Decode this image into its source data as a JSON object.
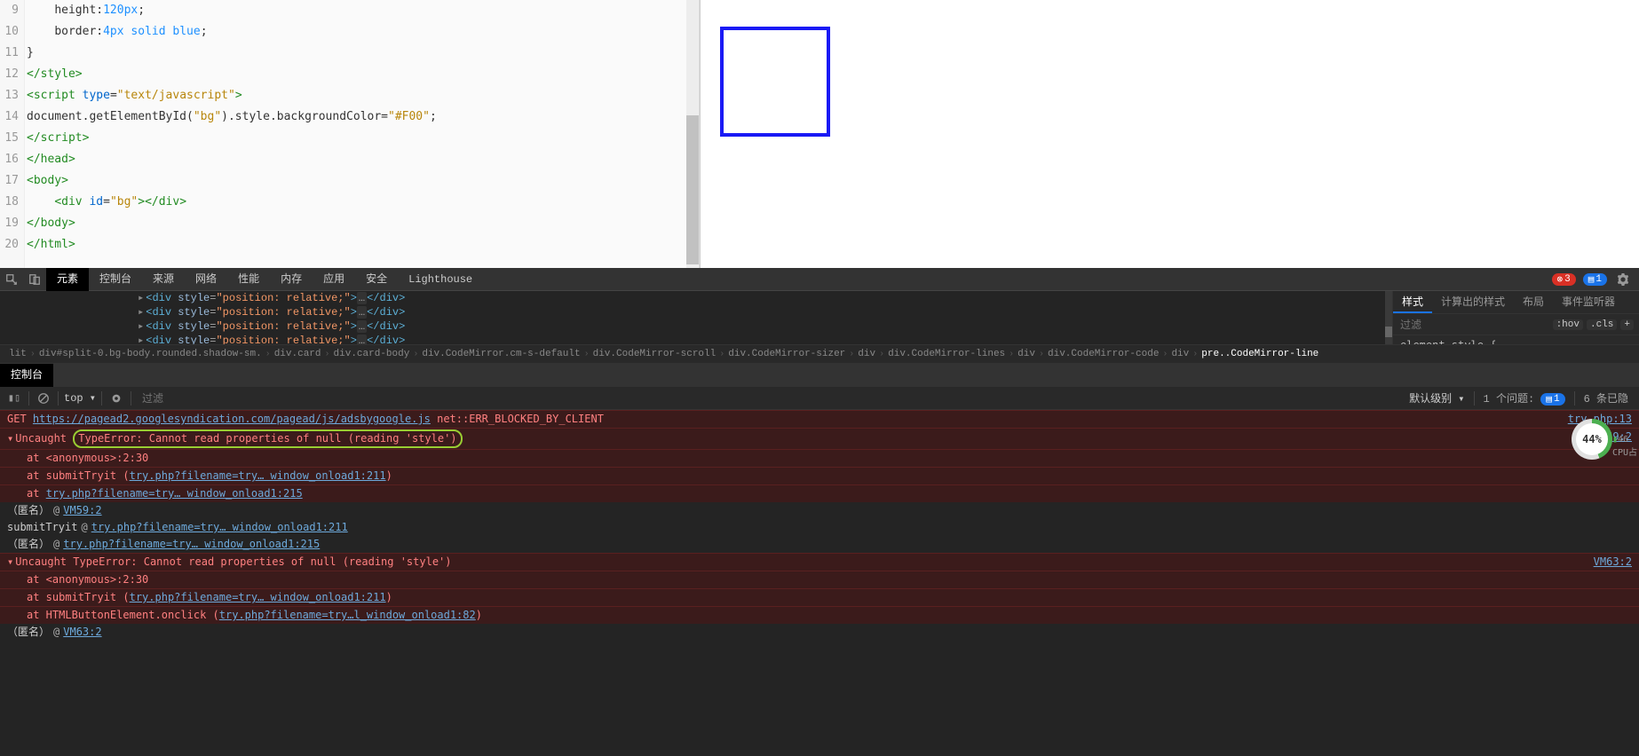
{
  "editor": {
    "lines_start": 9,
    "lines": [
      {
        "n": 9,
        "indent": "    ",
        "segs": [
          {
            "t": "height",
            "c": "plain"
          },
          {
            "t": ":",
            "c": "plain"
          },
          {
            "t": "120px",
            "c": "hl-blue"
          },
          {
            "t": ";",
            "c": "plain"
          }
        ]
      },
      {
        "n": 10,
        "indent": "    ",
        "segs": [
          {
            "t": "border",
            "c": "plain"
          },
          {
            "t": ":",
            "c": "plain"
          },
          {
            "t": "4px",
            "c": "hl-blue"
          },
          {
            "t": " ",
            "c": "plain"
          },
          {
            "t": "solid",
            "c": "hl-blue"
          },
          {
            "t": " ",
            "c": "plain"
          },
          {
            "t": "blue",
            "c": "hl-blue"
          },
          {
            "t": ";",
            "c": "plain"
          }
        ]
      },
      {
        "n": 11,
        "indent": "",
        "segs": [
          {
            "t": "}",
            "c": "plain"
          }
        ]
      },
      {
        "n": 12,
        "indent": "",
        "segs": [
          {
            "t": "</",
            "c": "tag"
          },
          {
            "t": "style",
            "c": "tag"
          },
          {
            "t": ">",
            "c": "tag"
          }
        ]
      },
      {
        "n": 13,
        "indent": "",
        "segs": [
          {
            "t": "<",
            "c": "tag"
          },
          {
            "t": "script",
            "c": "tag"
          },
          {
            "t": " ",
            "c": "plain"
          },
          {
            "t": "type",
            "c": "attr"
          },
          {
            "t": "=",
            "c": "plain"
          },
          {
            "t": "\"text/javascript\"",
            "c": "str"
          },
          {
            "t": ">",
            "c": "tag"
          }
        ]
      },
      {
        "n": 14,
        "indent": "",
        "segs": [
          {
            "t": "document.getElementById(",
            "c": "plain"
          },
          {
            "t": "\"bg\"",
            "c": "str"
          },
          {
            "t": ").style.backgroundColor=",
            "c": "plain"
          },
          {
            "t": "\"#F00\"",
            "c": "str"
          },
          {
            "t": ";",
            "c": "plain"
          }
        ]
      },
      {
        "n": 15,
        "indent": "",
        "segs": [
          {
            "t": "</",
            "c": "tag"
          },
          {
            "t": "script",
            "c": "tag"
          },
          {
            "t": ">",
            "c": "tag"
          }
        ]
      },
      {
        "n": 16,
        "indent": "",
        "segs": [
          {
            "t": "</",
            "c": "tag"
          },
          {
            "t": "head",
            "c": "tag"
          },
          {
            "t": ">",
            "c": "tag"
          }
        ]
      },
      {
        "n": 17,
        "indent": "",
        "segs": [
          {
            "t": "<",
            "c": "tag"
          },
          {
            "t": "body",
            "c": "tag"
          },
          {
            "t": ">",
            "c": "tag"
          }
        ]
      },
      {
        "n": 18,
        "indent": "    ",
        "segs": [
          {
            "t": "<",
            "c": "tag"
          },
          {
            "t": "div",
            "c": "tag"
          },
          {
            "t": " ",
            "c": "plain"
          },
          {
            "t": "id",
            "c": "attr"
          },
          {
            "t": "=",
            "c": "plain"
          },
          {
            "t": "\"bg\"",
            "c": "str"
          },
          {
            "t": ">",
            "c": "tag"
          },
          {
            "t": "</",
            "c": "tag"
          },
          {
            "t": "div",
            "c": "tag"
          },
          {
            "t": ">",
            "c": "tag"
          }
        ]
      },
      {
        "n": 19,
        "indent": "",
        "segs": [
          {
            "t": "</",
            "c": "tag"
          },
          {
            "t": "body",
            "c": "tag"
          },
          {
            "t": ">",
            "c": "tag"
          }
        ]
      },
      {
        "n": 20,
        "indent": "",
        "segs": [
          {
            "t": "</",
            "c": "tag"
          },
          {
            "t": "html",
            "c": "tag"
          },
          {
            "t": ">",
            "c": "tag"
          }
        ]
      }
    ]
  },
  "devtools_tabs": {
    "items": [
      "元素",
      "控制台",
      "来源",
      "网络",
      "性能",
      "内存",
      "应用",
      "安全",
      "Lighthouse"
    ],
    "active_index": 0,
    "errors_badge": "3",
    "info_badge": "1"
  },
  "elements_panel": {
    "visible_lines_count": 4,
    "line_markup": "<div style=\"position: relative;\">…</div>"
  },
  "breadcrumb": {
    "items": [
      "lit",
      "div#split-0.bg-body.rounded.shadow-sm.",
      "div.card",
      "div.card-body",
      "div.CodeMirror.cm-s-default",
      "div.CodeMirror-scroll",
      "div.CodeMirror-sizer",
      "div",
      "div.CodeMirror-lines",
      "div",
      "div.CodeMirror-code",
      "div",
      "pre..CodeMirror-line"
    ]
  },
  "styles_panel": {
    "tabs": [
      "样式",
      "计算出的样式",
      "布局",
      "事件监听器"
    ],
    "active_index": 0,
    "filter_placeholder": "过滤",
    "filter_buttons": [
      ":hov",
      ".cls",
      "+"
    ],
    "content_line1": "element.style {",
    "content_line2": "}"
  },
  "drawer": {
    "tab": "控制台"
  },
  "console_toolbar": {
    "context": "top ▾",
    "filter_placeholder": "过滤",
    "level_label": "默认级别 ▾",
    "issues_label": "1 个问题:",
    "issues_count": "1",
    "hidden_label": "6 条已隐"
  },
  "console": {
    "get_error": {
      "method": "GET",
      "url": "https://pagead2.googlesyndication.com/pagead/js/adsbygoogle.js",
      "suffix": "net::ERR_BLOCKED_BY_CLIENT",
      "source": "try.php:13"
    },
    "error1": {
      "prefix": "Uncaught ",
      "highlighted": "TypeError: Cannot read properties of null (reading 'style')",
      "source": "VM59:2",
      "stack": [
        {
          "kind": "at",
          "name": "<anonymous>:2:30"
        },
        {
          "kind": "at-fn",
          "fn": "submitTryit",
          "loc": "try.php?filename=try… window_onload1:211"
        },
        {
          "kind": "at-link",
          "loc": "try.php?filename=try… window_onload1:215"
        }
      ],
      "trace": [
        {
          "scope": "（匿名）",
          "at": "@",
          "src": "VM59:2"
        },
        {
          "scope": "submitTryit",
          "at": "@",
          "src": "try.php?filename=try… window_onload1:211"
        },
        {
          "scope": "（匿名）",
          "at": "@",
          "src": "try.php?filename=try… window_onload1:215"
        }
      ]
    },
    "error2": {
      "msg": "Uncaught TypeError: Cannot read properties of null (reading 'style')",
      "source": "VM63:2",
      "stack": [
        {
          "kind": "at",
          "name": "<anonymous>:2:30"
        },
        {
          "kind": "at-fn",
          "fn": "submitTryit",
          "loc": "try.php?filename=try… window_onload1:211"
        },
        {
          "kind": "at-fn",
          "fn": "HTMLButtonElement.onclick",
          "loc": "try.php?filename=try…l_window_onload1:82"
        }
      ],
      "trace": [
        {
          "scope": "（匿名）",
          "at": "@",
          "src": "VM63:2"
        }
      ]
    }
  },
  "cpu": {
    "percent": "44%",
    "label": "CPU占",
    "side": "46"
  }
}
